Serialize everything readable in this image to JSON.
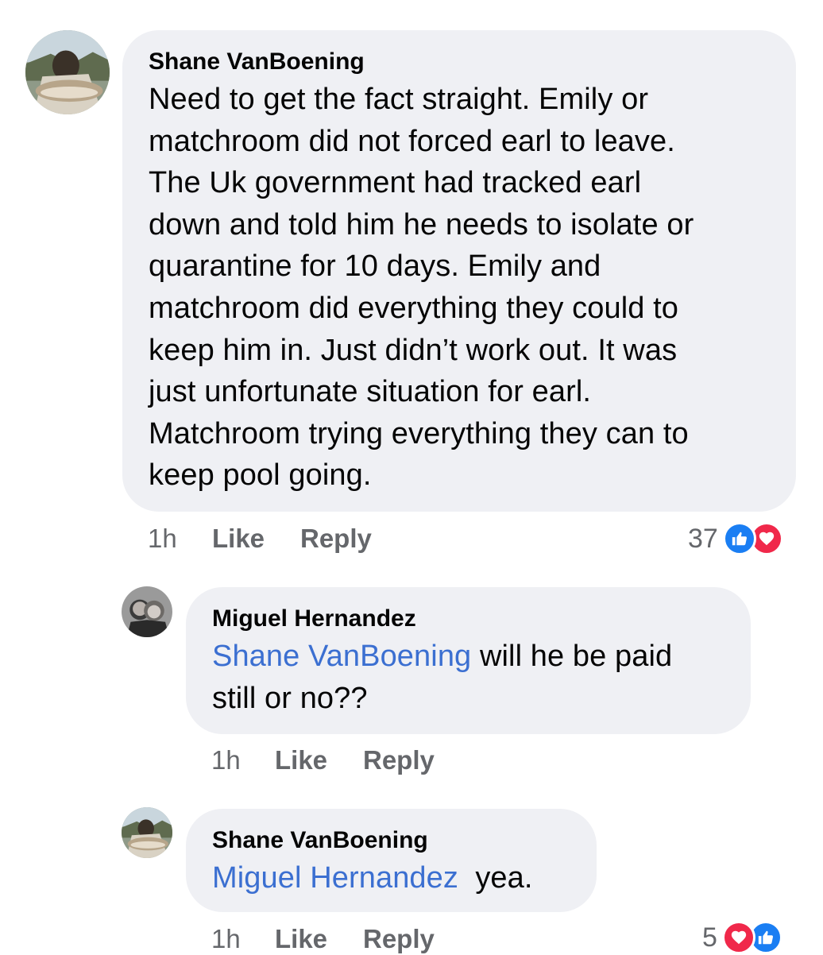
{
  "comments": [
    {
      "author": "Shane VanBoening",
      "lines": [
        "Need to get the fact straight. Emily or",
        "matchroom did not forced earl to leave.",
        "The Uk government had tracked earl",
        "down and told him he needs to isolate or",
        "quarantine for 10 days. Emily and",
        "matchroom did everything they could to",
        "keep him in. Just didn’t work out. It was",
        "just unfortunate situation for earl.",
        "Matchroom trying everything they can to",
        "keep pool going."
      ],
      "time": "1h",
      "like_label": "Like",
      "reply_label": "Reply",
      "reaction_count": "37",
      "reactions": [
        "like-icon",
        "love-icon"
      ]
    },
    {
      "author": "Miguel Hernandez",
      "mention": "Shane VanBoening",
      "line1_rest": " will he be paid",
      "line2": "still or no??",
      "time": "1h",
      "like_label": "Like",
      "reply_label": "Reply"
    },
    {
      "author": "Shane VanBoening",
      "mention": "Miguel Hernandez",
      "text_rest": "  yea.",
      "time": "1h",
      "like_label": "Like",
      "reply_label": "Reply",
      "reaction_count": "5",
      "reactions": [
        "love-icon",
        "like-icon"
      ]
    }
  ],
  "colors": {
    "bubble": "#eff0f4",
    "mention": "#3b6fd1",
    "meta": "#65676b",
    "like": "#1a7ef3",
    "love": "#f0284a"
  }
}
